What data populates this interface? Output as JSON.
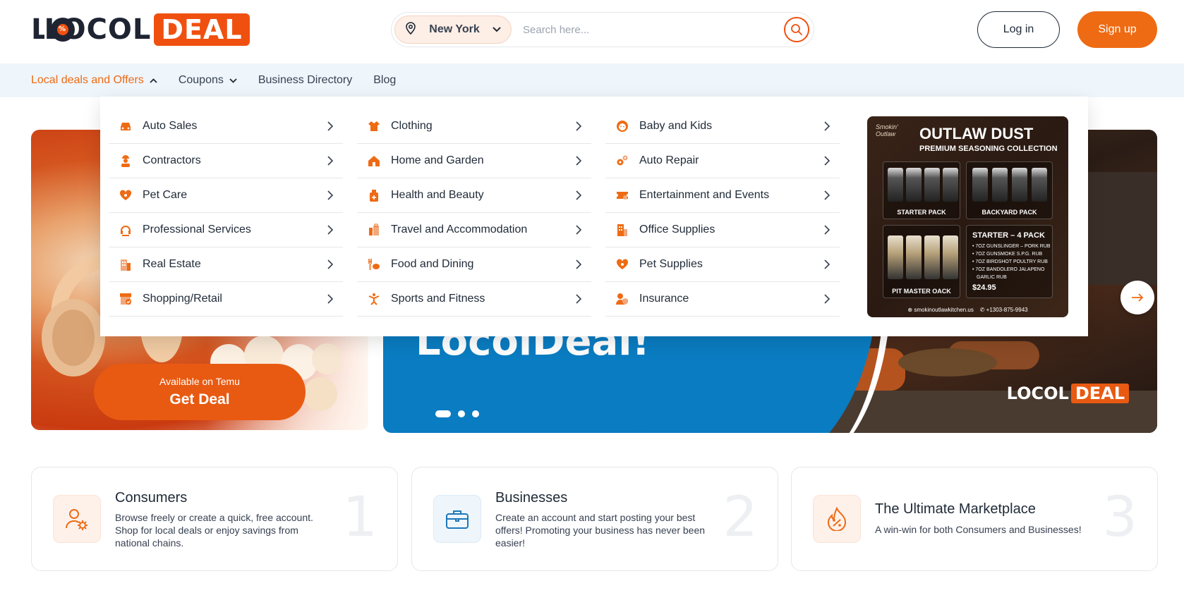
{
  "brand": {
    "logo_text_1": "LOCOL",
    "logo_text_2": "DEAL",
    "accent": "#ee6b14"
  },
  "header": {
    "location": "New York",
    "search_placeholder": "Search here...",
    "login_label": "Log in",
    "signup_label": "Sign up"
  },
  "nav": {
    "items": [
      {
        "label": "Local deals and Offers"
      },
      {
        "label": "Coupons"
      },
      {
        "label": "Business Directory"
      },
      {
        "label": "Blog"
      }
    ]
  },
  "mega_menu": {
    "columns": [
      [
        {
          "label": "Auto Sales",
          "icon": "car-icon"
        },
        {
          "label": "Contractors",
          "icon": "worker-icon"
        },
        {
          "label": "Pet Care",
          "icon": "paw-heart-icon"
        },
        {
          "label": "Professional Services",
          "icon": "headset-icon"
        },
        {
          "label": "Real Estate",
          "icon": "building-icon"
        },
        {
          "label": "Shopping/Retail",
          "icon": "store-icon"
        }
      ],
      [
        {
          "label": "Clothing",
          "icon": "shirt-icon"
        },
        {
          "label": "Home and Garden",
          "icon": "home-icon"
        },
        {
          "label": "Health and Beauty",
          "icon": "bottle-icon"
        },
        {
          "label": "Travel and Accommodation",
          "icon": "luggage-icon"
        },
        {
          "label": "Food and Dining",
          "icon": "dining-icon"
        },
        {
          "label": "Sports and Fitness",
          "icon": "fitness-icon"
        }
      ],
      [
        {
          "label": "Baby and Kids",
          "icon": "baby-icon"
        },
        {
          "label": "Auto Repair",
          "icon": "gears-icon"
        },
        {
          "label": "Entertainment and Events",
          "icon": "ticket-icon"
        },
        {
          "label": "Office Supplies",
          "icon": "office-icon"
        },
        {
          "label": "Pet Supplies",
          "icon": "paw-heart-icon"
        },
        {
          "label": "Insurance",
          "icon": "shield-person-icon"
        }
      ]
    ],
    "promo": {
      "brand": "Smokin' Outlaw",
      "title": "OUTLAW DUST",
      "subtitle": "PREMIUM SEASONING COLLECTION",
      "pack_1": "STARTER PACK",
      "pack_2": "BACKYARD PACK",
      "pack_3": "PIT MASTER OACK",
      "starter_title": "STARTER – 4 PACK",
      "starter_items": [
        "• 7OZ GUNSLINGER – PORK RUB",
        "• 7OZ GUNSMOKE S.P.G. RUB",
        "• 7OZ BIRDSHOT POULTRY RUB",
        "• 7OZ BANDOLERO JALAPENO",
        "GARLIC RUB"
      ],
      "price": "$24.95",
      "website": "⊕ smokinoutlawkitchen.us",
      "phone": "✆ +1303-875-9943"
    }
  },
  "hero": {
    "left": {
      "cta_sub": "Available on Temu",
      "cta_main": "Get Deal"
    },
    "right": {
      "title_fragment": "LocolDeal!",
      "watermark_1": "LOCOL",
      "watermark_2": "DEAL",
      "slide_count": 3,
      "active_slide": 1
    }
  },
  "features": [
    {
      "title": "Consumers",
      "desc": "Browse freely or create a quick, free account. Shop for local deals or enjoy savings from national chains.",
      "num": "1",
      "icon": "user-gear-icon"
    },
    {
      "title": "Businesses",
      "desc": "Create an account and start posting your best offers! Promoting your business has never been easier!",
      "num": "2",
      "icon": "briefcase-icon"
    },
    {
      "title": "The Ultimate Marketplace",
      "desc": "A win-win for both Consumers and Businesses!",
      "num": "3",
      "icon": "flame-percent-icon"
    }
  ]
}
